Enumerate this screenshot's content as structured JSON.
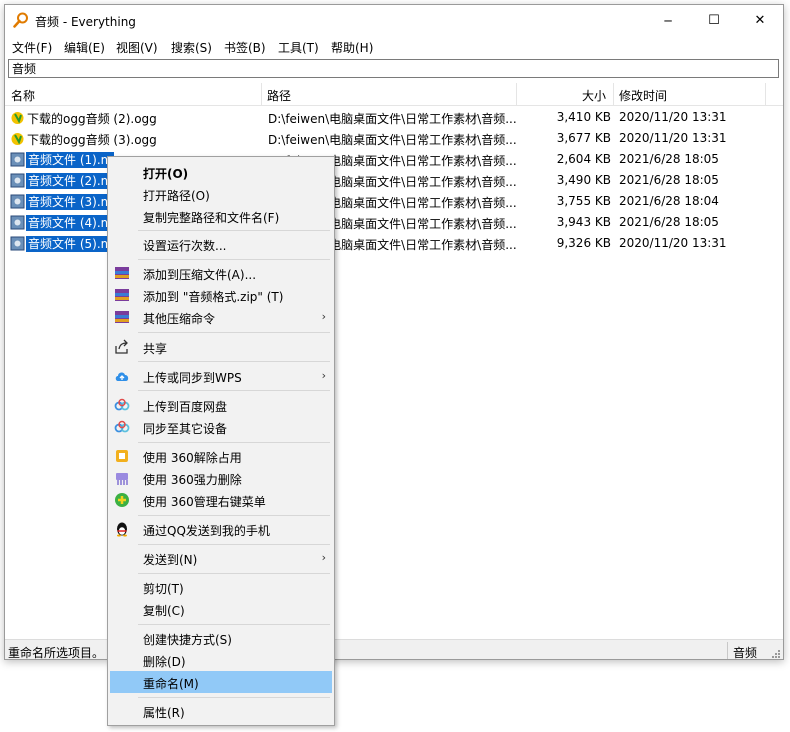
{
  "window": {
    "title": "音频 - Everything",
    "controls": {
      "minimize": "─",
      "maximize": "☐",
      "close": "✕"
    }
  },
  "menu": [
    "文件(F)",
    "编辑(E)",
    "视图(V)",
    "搜索(S)",
    "书签(B)",
    "工具(T)",
    "帮助(H)"
  ],
  "search": {
    "value": "音频"
  },
  "columns": {
    "name": "名称",
    "path": "路径",
    "size": "大小",
    "modified": "修改时间"
  },
  "rows": [
    {
      "name": "下载的ogg音频 (2).ogg",
      "path": "D:\\feiwen\\电脑桌面文件\\日常工作素材\\音频...",
      "size": "3,410 KB",
      "modified": "2020/11/20 13:31",
      "icon": "ogg-audio-icon",
      "selected": false
    },
    {
      "name": "下载的ogg音频 (3).ogg",
      "path": "D:\\feiwen\\电脑桌面文件\\日常工作素材\\音频...",
      "size": "3,677 KB",
      "modified": "2020/11/20 13:31",
      "icon": "ogg-audio-icon",
      "selected": false
    },
    {
      "name": "音频文件 (1).m",
      "path": "D:\\feiwen\\电脑桌面文件\\日常工作素材\\音频...",
      "size": "2,604 KB",
      "modified": "2021/6/28 18:05",
      "icon": "audio-file-icon",
      "selected": true
    },
    {
      "name": "音频文件 (2).m",
      "path": "D:\\feiwen\\电脑桌面文件\\日常工作素材\\音频...",
      "size": "3,490 KB",
      "modified": "2021/6/28 18:05",
      "icon": "audio-file-icon",
      "selected": true
    },
    {
      "name": "音频文件 (3).m",
      "path": "D:\\feiwen\\电脑桌面文件\\日常工作素材\\音频...",
      "size": "3,755 KB",
      "modified": "2021/6/28 18:04",
      "icon": "audio-file-icon",
      "selected": true
    },
    {
      "name": "音频文件 (4).m",
      "path": "D:\\feiwen\\电脑桌面文件\\日常工作素材\\音频...",
      "size": "3,943 KB",
      "modified": "2021/6/28 18:05",
      "icon": "audio-file-icon",
      "selected": true
    },
    {
      "name": "音频文件 (5).m",
      "path": "D:\\feiwen\\电脑桌面文件\\日常工作素材\\音频...",
      "size": "9,326 KB",
      "modified": "2020/11/20 13:31",
      "icon": "audio-file-icon",
      "selected": true
    }
  ],
  "status": {
    "left": "重命名所选项目。",
    "right": "音频"
  },
  "context_menu": {
    "open": "打开(O)",
    "open_path": "打开路径(O)",
    "copy_full_path": "复制完整路径和文件名(F)",
    "set_run_count": "设置运行次数...",
    "add_to_archive": "添加到压缩文件(A)...",
    "add_to_zip": "添加到 \"音频格式.zip\" (T)",
    "other_compress": "其他压缩命令",
    "share": "共享",
    "upload_wps": "上传或同步到WPS",
    "upload_baidu": "上传到百度网盘",
    "sync_devices": "同步至其它设备",
    "unlock_360": "使用 360解除占用",
    "force_delete_360": "使用 360强力删除",
    "manage_menu_360": "使用 360管理右键菜单",
    "send_qq": "通过QQ发送到我的手机",
    "send_to": "发送到(N)",
    "cut": "剪切(T)",
    "copy": "复制(C)",
    "create_shortcut": "创建快捷方式(S)",
    "delete": "删除(D)",
    "rename": "重命名(M)",
    "properties": "属性(R)",
    "submenu_arrow": "›"
  },
  "colors": {
    "selection": "#0a64c8",
    "menu_highlight": "#91c9f7"
  }
}
